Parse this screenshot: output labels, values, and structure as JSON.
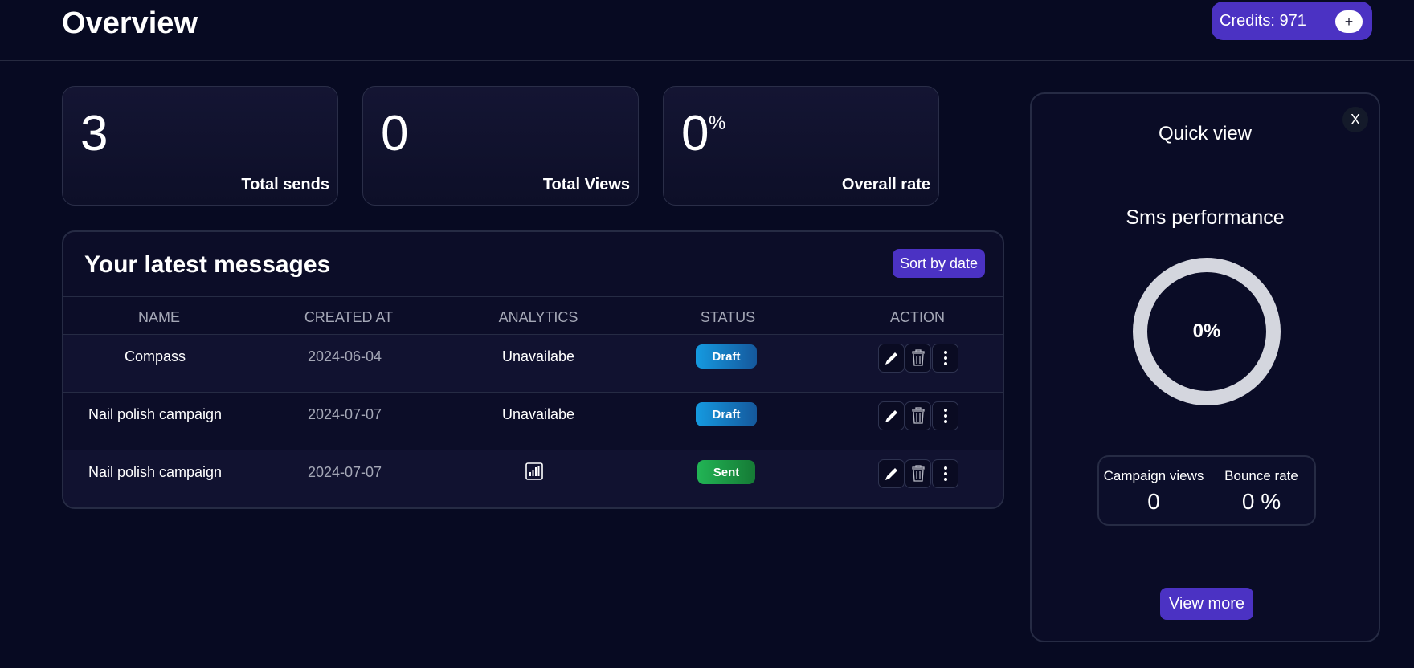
{
  "header": {
    "title": "Overview",
    "credits_label": "Credits: 971",
    "credits_add": "+"
  },
  "stats": [
    {
      "value": "3",
      "suffix": "",
      "label": "Total sends"
    },
    {
      "value": "0",
      "suffix": "",
      "label": "Total Views"
    },
    {
      "value": "0",
      "suffix": "%",
      "label": "Overall rate"
    }
  ],
  "messages": {
    "title": "Your latest messages",
    "sort_label": "Sort by date",
    "columns": [
      "NAME",
      "CREATED AT",
      "ANALYTICS",
      "STATUS",
      "ACTION"
    ],
    "rows": [
      {
        "name": "Compass",
        "created_at": "2024-06-04",
        "analytics": "Unavailabe",
        "status": "Draft"
      },
      {
        "name": "Nail polish campaign",
        "created_at": "2024-07-07",
        "analytics": "Unavailabe",
        "status": "Draft"
      },
      {
        "name": "Nail polish campaign",
        "created_at": "2024-07-07",
        "analytics": "",
        "analytics_icon": "bar-chart-icon",
        "status": "Sent"
      }
    ]
  },
  "quick_view": {
    "title": "Quick view",
    "close": "X",
    "subtitle": "Sms performance",
    "performance_value": "0%",
    "performance_fraction": 0,
    "campaign_views_label": "Campaign views",
    "campaign_views_value": "0",
    "bounce_rate_label": "Bounce rate",
    "bounce_rate_value": "0 %",
    "view_more_label": "View more"
  },
  "colors": {
    "background": "#070a22",
    "accent": "#4b32c3",
    "draft": "#159ae0",
    "sent": "#22b455",
    "donut_track": "#d4d6de"
  },
  "icons": {
    "edit": "pencil-icon",
    "delete": "trash-icon",
    "more": "vertical-dots-icon",
    "analytics": "bar-chart-icon"
  }
}
